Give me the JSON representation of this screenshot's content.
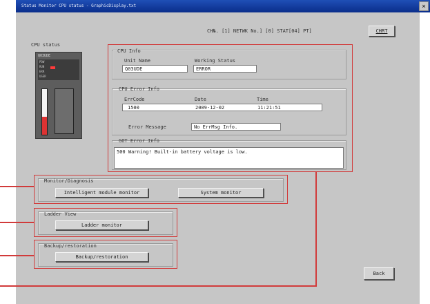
{
  "window": {
    "title": "Status Monitor CPU status - GraphicDisplay.txt",
    "close_glyph": "×"
  },
  "header": {
    "connection_text": "CH№. [1] NETWK No.] [0] STAT[04] PT]",
    "chart_button": "CHRT"
  },
  "cpu_status": {
    "label": "CPU status",
    "model": "Q03UDE",
    "led_rows": [
      "POW",
      "RUN",
      "ERR",
      "USER"
    ]
  },
  "cpu_info": {
    "label": "CPU Info",
    "unit_name_label": "Unit Name",
    "unit_name_value": "Q03UDE",
    "working_status_label": "Working Status",
    "working_status_value": "ERROR"
  },
  "cpu_error": {
    "label": "CPU Error Info",
    "errcode_label": "ErrCode",
    "errcode_value": "1500",
    "date_label": "Date",
    "date_value": "2009-12-02",
    "time_label": "Time",
    "time_value": "11:21:51",
    "error_message_label": "Error Message",
    "error_message_value": "No ErrMsg Info."
  },
  "got_error": {
    "label": "GOT Error Info",
    "message": "500 Warning! Built-in battery voltage is low."
  },
  "monitor": {
    "label": "Monitor/Diagnosis",
    "intelligent_button": "Intelligent module monitor",
    "system_button": "System monitor"
  },
  "ladder": {
    "label": "Ladder View",
    "ladder_button": "Ladder monitor"
  },
  "backup": {
    "label": "Backup/restoration",
    "backup_button": "Backup/restoration"
  },
  "footer": {
    "back_button": "Back"
  },
  "colors": {
    "highlight": "#d13a3a",
    "window_bg": "#c6c6c6",
    "titlebar": "#1f4fb6"
  }
}
